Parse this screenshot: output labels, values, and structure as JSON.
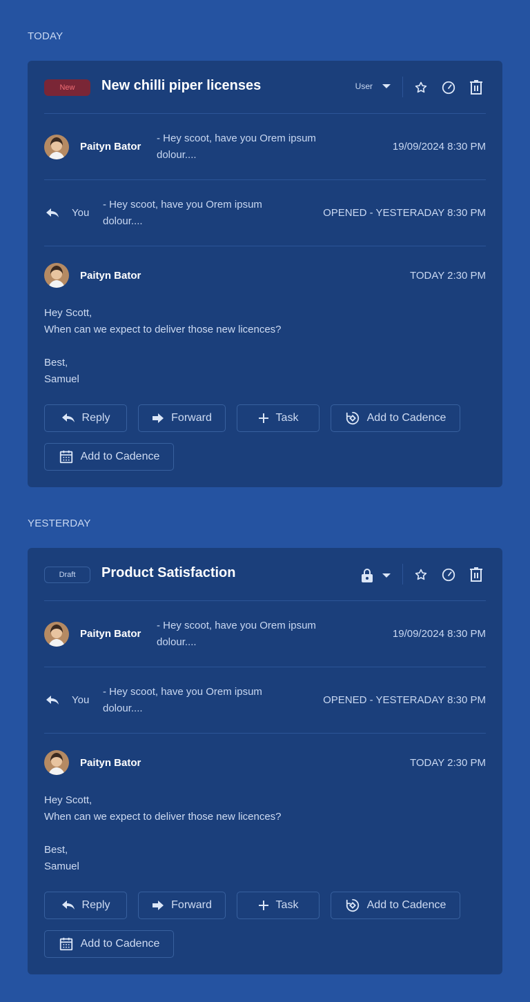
{
  "sections": [
    {
      "label": "TODAY",
      "card": {
        "badge": "New",
        "title": "New chilli piper licenses",
        "owner": "User",
        "first_row": {
          "name": "Paityn Bator",
          "snippet": "- Hey scoot, have you Orem ipsum dolour....",
          "time": "19/09/2024 8:30 PM"
        },
        "reply_row": {
          "sender": "You",
          "snippet": "- Hey scoot, have you Orem ipsum dolour....",
          "status": "OPENED - YESTERADAY 8:30 PM"
        },
        "message": {
          "name": "Paityn Bator",
          "time": "TODAY 2:30 PM",
          "lines": [
            "Hey Scott,",
            "When can we expect to deliver those new licences?",
            "",
            "Best,",
            "Samuel"
          ]
        },
        "actions": {
          "reply": "Reply",
          "forward": "Forward",
          "task": "Task",
          "cadence": "Add to Cadence",
          "cadence2": "Add to Cadence"
        }
      }
    },
    {
      "label": "YESTERDAY",
      "card": {
        "badge": "Draft",
        "title": "Product Satisfaction",
        "first_row": {
          "name": "Paityn Bator",
          "snippet": "- Hey scoot, have you Orem ipsum dolour....",
          "time": "19/09/2024 8:30 PM"
        },
        "reply_row": {
          "sender": "You",
          "snippet": "- Hey scoot, have you Orem ipsum dolour....",
          "status": "OPENED - YESTERADAY 8:30 PM"
        },
        "message": {
          "name": "Paityn Bator",
          "time": "TODAY 2:30 PM",
          "lines": [
            "Hey Scott,",
            "When can we expect to deliver those new licences?",
            "",
            "Best,",
            "Samuel"
          ]
        },
        "actions": {
          "reply": "Reply",
          "forward": "Forward",
          "task": "Task",
          "cadence": "Add to Cadence",
          "cadence2": "Add to Cadence"
        }
      }
    }
  ],
  "colors": {
    "background": "#2553a1",
    "card": "#1b3f7b",
    "new_badge": "#7a2636",
    "new_text": "#ef6d74"
  },
  "icons": [
    "star-icon",
    "speed-icon",
    "trash-icon",
    "reply-icon",
    "forward-icon",
    "plus-icon",
    "cadence-icon",
    "calendar-icon",
    "lock-icon",
    "chevron-down-icon"
  ]
}
